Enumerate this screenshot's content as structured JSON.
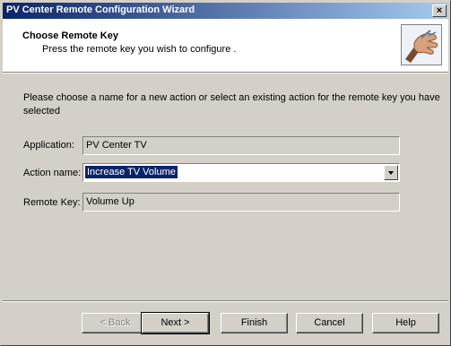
{
  "window": {
    "title": "PV Center Remote Configuration Wizard",
    "close_glyph": "×"
  },
  "header": {
    "title": "Choose Remote Key",
    "subtitle": "Press the remote key you wish to configure ."
  },
  "instruction": "Please choose a name for a new action or select an existing action for the remote key you have selected",
  "fields": {
    "application_label": "Application:",
    "application_value": "PV Center TV",
    "action_label": "Action name:",
    "action_value": "Increase TV Volume",
    "remote_key_label": "Remote Key:",
    "remote_key_value": "Volume Up"
  },
  "buttons": {
    "back": "< Back",
    "next": "Next >",
    "finish": "Finish",
    "cancel": "Cancel",
    "help": "Help"
  },
  "colors": {
    "titlebar_start": "#0a246a",
    "titlebar_end": "#a6caf0",
    "face": "#d4d0c8",
    "selection": "#0a246a"
  },
  "icons": {
    "header": "hand-remote-icon",
    "close": "close-icon",
    "dropdown": "chevron-down-icon"
  }
}
